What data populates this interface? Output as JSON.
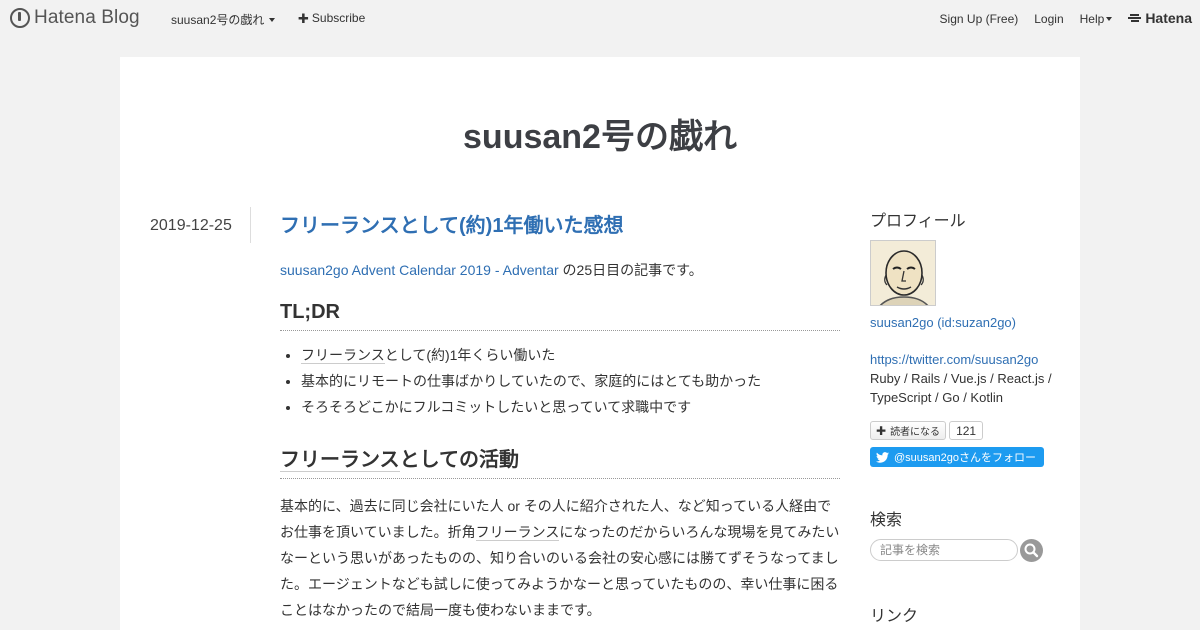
{
  "header": {
    "logo_text": "Hatena Blog",
    "blog_menu_label": "suusan2号の戯れ",
    "subscribe_label": "Subscribe",
    "signup_label": "Sign Up (Free)",
    "login_label": "Login",
    "help_label": "Help",
    "hatena_label": "Hatena"
  },
  "blog": {
    "title": "suusan2号の戯れ"
  },
  "entry": {
    "date": "2019-12-25",
    "title": "フリーランスとして(約)1年働いた感想",
    "intro_link": "suusan2go Advent Calendar 2019 - Adventar",
    "intro_suffix": " の25日目の記事です。",
    "tldr_heading": "TL;DR",
    "tldr_items": [
      {
        "kw": "フリーランス",
        "rest": "として(約)1年くらい働いた"
      },
      {
        "kw": "",
        "rest": "基本的にリモートの仕事ばかりしていたので、家庭的にはとても助かった"
      },
      {
        "kw": "",
        "rest": "そろそろどこかにフルコミットしたいと思っていて求職中です"
      }
    ],
    "activity_heading_kw": "フリーランス",
    "activity_heading_rest": "としての活動",
    "para_part1": "基本的に、過去に同じ会社にいた人 or その人に紹介された人、など知っている人経由でお仕事を頂いていました。折角",
    "para_kw": "フリーランス",
    "para_part2": "になったのだからいろんな現場を見てみたいなーという思いがあったものの、知り合いのいる会社の安心感には勝てずそうなってました。エージェントなども試しに使ってみようかなーと思っていたものの、幸い仕事に困ることはなかったので結局一度も使わないままです。"
  },
  "sidebar": {
    "profile_heading": "プロフィール",
    "profile_link": "suusan2go (id:suzan2go)",
    "twitter_url": "https://twitter.com/suusan2go",
    "bio": "Ruby / Rails / Vue.js / React.js / TypeScript / Go / Kotlin",
    "subscribe_button": "読者になる",
    "subscriber_count": "121",
    "twitter_follow": "@suusan2goさんをフォロー",
    "search_heading": "検索",
    "search_placeholder": "記事を検索",
    "links_heading": "リンク"
  },
  "colors": {
    "link": "#2f6fb3",
    "twitter": "#1d9bf0",
    "page_bg": "#f2f2f2"
  }
}
